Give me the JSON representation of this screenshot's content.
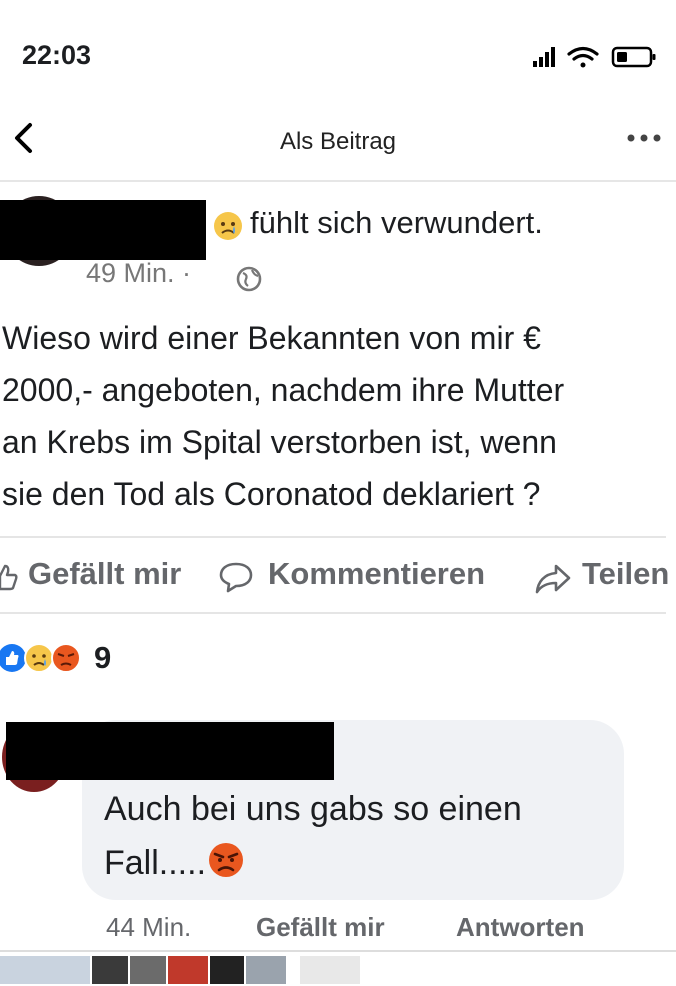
{
  "status_bar": {
    "time": "22:03"
  },
  "nav": {
    "title": "Als Beitrag"
  },
  "post": {
    "feeling": "fühlt sich verwundert.",
    "time": "49 Min. ·",
    "body": "Wieso wird einer Bekannten von mir €\n2000,- angeboten, nachdem ihre Mutter\nan Krebs im Spital verstorben ist, wenn\nsie den Tod als Coronatod deklariert ?",
    "actions": {
      "like": "Gefällt mir",
      "comment": "Kommentieren",
      "share": "Teilen"
    },
    "reactions": {
      "count": "9"
    }
  },
  "comment": {
    "text": "Auch bei uns gabs so einen Fall.....",
    "time": "44 Min.",
    "like": "Gefällt mir",
    "reply": "Antworten"
  },
  "icons": [
    "back-icon",
    "more-icon",
    "signal-icon",
    "wifi-icon",
    "battery-icon",
    "globe-icon",
    "like-icon",
    "comment-icon",
    "share-icon",
    "sad-emoji",
    "angry-emoji"
  ],
  "colors": {
    "facebook_blue": "#1877f2",
    "angry": "#e9571f",
    "bubble": "#f0f2f5"
  }
}
